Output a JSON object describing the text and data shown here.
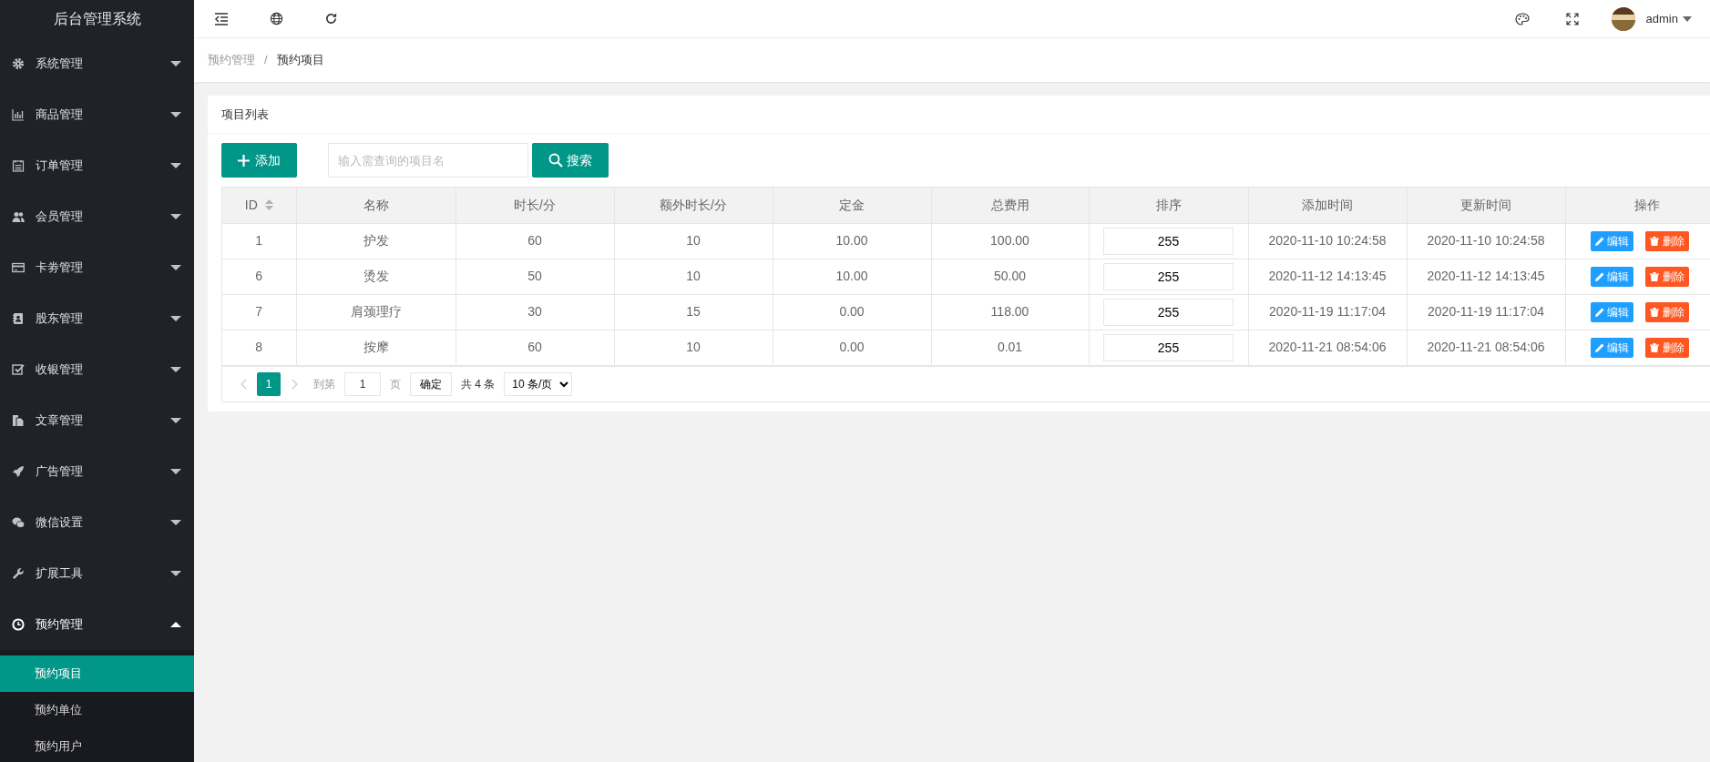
{
  "sidebar": {
    "title": "后台管理系统",
    "menus": [
      {
        "label": "系统管理",
        "expanded": false
      },
      {
        "label": "商品管理",
        "expanded": false
      },
      {
        "label": "订单管理",
        "expanded": false
      },
      {
        "label": "会员管理",
        "expanded": false
      },
      {
        "label": "卡劵管理",
        "expanded": false
      },
      {
        "label": "股东管理",
        "expanded": false
      },
      {
        "label": "收银管理",
        "expanded": false
      },
      {
        "label": "文章管理",
        "expanded": false
      },
      {
        "label": "广告管理",
        "expanded": false
      },
      {
        "label": "微信设置",
        "expanded": false
      },
      {
        "label": "扩展工具",
        "expanded": false
      },
      {
        "label": "预约管理",
        "expanded": true,
        "children": [
          {
            "label": "预约项目",
            "selected": true
          },
          {
            "label": "预约单位",
            "selected": false
          },
          {
            "label": "预约用户",
            "selected": false
          }
        ]
      }
    ]
  },
  "header": {
    "user": "admin"
  },
  "breadcrumb": {
    "separator": "/",
    "items": [
      "预约管理",
      "预约项目"
    ]
  },
  "card": {
    "title": "项目列表",
    "add_button": "添加",
    "search": {
      "placeholder": "输入需查询的项目名"
    },
    "search_button": "搜索"
  },
  "table": {
    "columns": [
      {
        "label": "ID",
        "sortable": true
      },
      {
        "label": "名称",
        "sortable": false
      },
      {
        "label": "时长/分",
        "sortable": false
      },
      {
        "label": "额外时长/分",
        "sortable": false
      },
      {
        "label": "定金",
        "sortable": false
      },
      {
        "label": "总费用",
        "sortable": false
      },
      {
        "label": "排序",
        "sortable": false
      },
      {
        "label": "添加时间",
        "sortable": false
      },
      {
        "label": "更新时间",
        "sortable": false
      },
      {
        "label": "操作",
        "sortable": false
      }
    ],
    "rows": [
      {
        "id": "1",
        "name": "护发",
        "duration": "60",
        "extra": "10",
        "deposit": "10.00",
        "total": "100.00",
        "sort": "255",
        "created": "2020-11-10 10:24:58",
        "updated": "2020-11-10 10:24:58",
        "edit": "编辑",
        "delete": "删除"
      },
      {
        "id": "6",
        "name": "烫发",
        "duration": "50",
        "extra": "10",
        "deposit": "10.00",
        "total": "50.00",
        "sort": "255",
        "created": "2020-11-12 14:13:45",
        "updated": "2020-11-12 14:13:45",
        "edit": "编辑",
        "delete": "删除"
      },
      {
        "id": "7",
        "name": "肩颈理疗",
        "duration": "30",
        "extra": "15",
        "deposit": "0.00",
        "total": "118.00",
        "sort": "255",
        "created": "2020-11-19 11:17:04",
        "updated": "2020-11-19 11:17:04",
        "edit": "编辑",
        "delete": "删除"
      },
      {
        "id": "8",
        "name": "按摩",
        "duration": "60",
        "extra": "10",
        "deposit": "0.00",
        "total": "0.01",
        "sort": "255",
        "created": "2020-11-21 08:54:06",
        "updated": "2020-11-21 08:54:06",
        "edit": "编辑",
        "delete": "删除"
      }
    ]
  },
  "pagination": {
    "pages": [
      {
        "label": "1",
        "selected": true
      }
    ],
    "goto_label": "到第",
    "goto_value": "1",
    "page_unit": "页",
    "confirm": "确定",
    "total": "共 4 条",
    "page_size": "10 条/页"
  }
}
